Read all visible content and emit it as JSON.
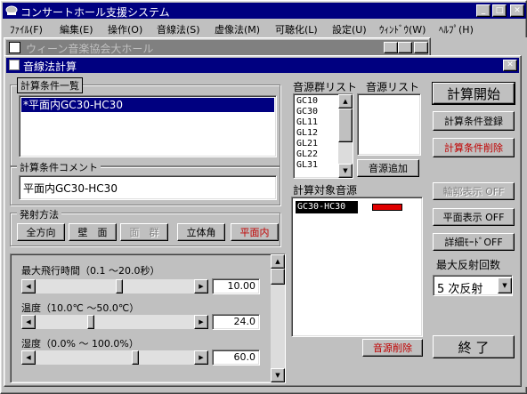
{
  "app": {
    "title": "コンサートホール支援システム"
  },
  "menu": [
    "ﾌｧｲﾙ(F)",
    "編集(E)",
    "操作(O)",
    "音線法(S)",
    "虚像法(M)",
    "可聴化(L)",
    "設定(U)",
    "ｳｨﾝﾄﾞｳ(W)",
    "ﾍﾙﾌﾟ(H)"
  ],
  "bg_window": {
    "title": "ウィーン音楽協会大ホール"
  },
  "dialog": {
    "title": "音線法計算"
  },
  "conditions": {
    "label": "計算条件一覧",
    "items": [
      "*平面内GC30-HC30"
    ]
  },
  "comment": {
    "label": "計算条件コメント",
    "value": "平面内GC30-HC30"
  },
  "emission": {
    "label": "発射方法",
    "buttons": [
      "全方向",
      "壁　面",
      "面　群",
      "立体角",
      "平面内"
    ]
  },
  "params": [
    {
      "label": "最大飛行時間（0.1 ～20.0秒）",
      "value": "10.00",
      "fill": 0.5
    },
    {
      "label": "温度（10.0℃ ～50.0℃）",
      "value": "24.0",
      "fill": 0.35
    },
    {
      "label": "湿度（0.0% ～ 100.0%）",
      "value": "60.0",
      "fill": 0.6
    }
  ],
  "source_group": {
    "label": "音源群リスト",
    "items": [
      "GC10",
      "GC30",
      "GL11",
      "GL12",
      "GL21",
      "GL22",
      "GL31"
    ]
  },
  "source_list": {
    "label": "音源リスト",
    "items": []
  },
  "add_source_button": "音源追加",
  "target": {
    "label": "計算対象音源",
    "items": [
      {
        "name": "GC30-HC30",
        "color": "#e00000"
      }
    ]
  },
  "delete_source_button": "音源削除",
  "actions": {
    "start": "計算開始",
    "register": "計算条件登録",
    "delete": "計算条件削除",
    "contour": "輪郭表示 OFF",
    "plane": "平面表示 OFF",
    "detail": "詳細ﾓｰﾄﾞOFF"
  },
  "reflection": {
    "label": "最大反射回数",
    "value": "5 次反射"
  },
  "close_button": "終 了"
}
